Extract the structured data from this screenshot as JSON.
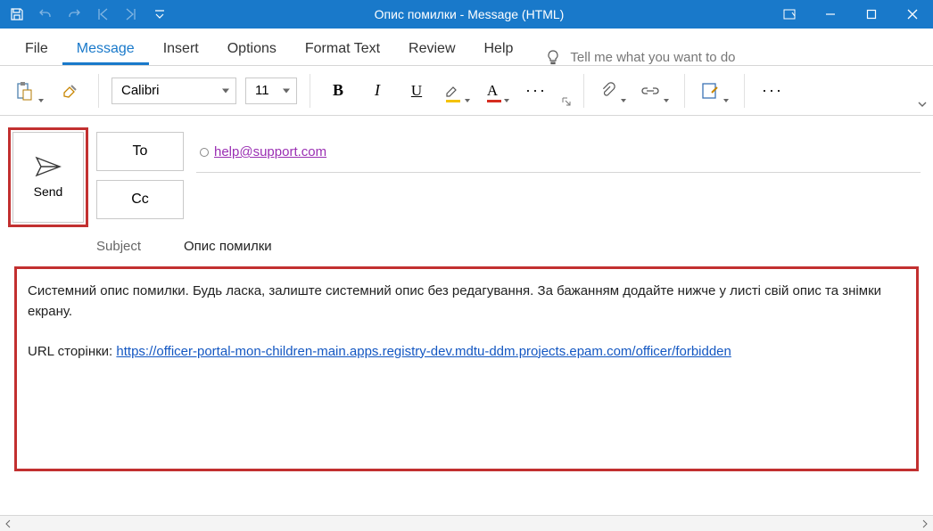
{
  "title": "Опис помилки  -  Message (HTML)",
  "tabs": {
    "file": "File",
    "message": "Message",
    "insert": "Insert",
    "options": "Options",
    "formattext": "Format Text",
    "review": "Review",
    "help": "Help",
    "tellme": "Tell me what you want to do"
  },
  "ribbon": {
    "font": "Calibri",
    "size": "11",
    "bold": "B",
    "italic": "I",
    "underline": "U",
    "letterA": "A",
    "ellipsis": "···"
  },
  "compose": {
    "send": "Send",
    "to_btn": "To",
    "cc_btn": "Cc",
    "to_value": "help@support.com",
    "subject_label": "Subject",
    "subject_value": "Опис помилки"
  },
  "body": {
    "para1": "Системний опис помилки. Будь ласка, залиште системний опис без редагування. За бажанням додайте нижче у листі свій опис та знімки екрану.",
    "url_label": "URL сторінки: ",
    "url": "https://officer-portal-mon-children-main.apps.registry-dev.mdtu-ddm.projects.epam.com/officer/forbidden"
  }
}
